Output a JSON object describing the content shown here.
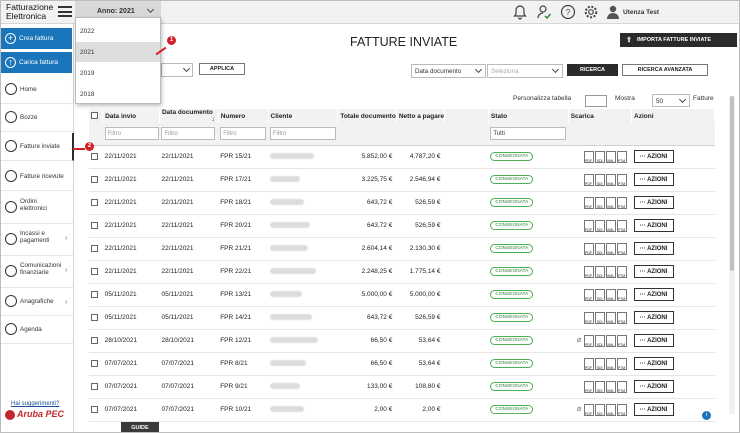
{
  "brand": {
    "line1": "Fatturazione",
    "line2": "Elettronica"
  },
  "year_select": {
    "label": "Anno: 2021"
  },
  "year_dropdown": {
    "options": [
      "2022",
      "2021",
      "2019",
      "2018"
    ],
    "selected": "2021"
  },
  "user": {
    "name": "Utenza Test"
  },
  "sidebar": {
    "buttons": [
      {
        "label": "Crea fattura"
      },
      {
        "label": "Carica fattura"
      }
    ],
    "items": [
      {
        "label": "Home",
        "icon": "home-icon"
      },
      {
        "label": "Bozze",
        "icon": "drafts-icon"
      },
      {
        "label": "Fatture inviate",
        "icon": "sent-icon"
      },
      {
        "label": "Fatture ricevute",
        "icon": "received-icon"
      },
      {
        "label": "Ordini elettronici",
        "icon": "orders-icon"
      },
      {
        "label": "Incassi e pagamenti",
        "icon": "payments-icon"
      },
      {
        "label": "Comunicazioni finanziarie",
        "icon": "communications-icon"
      },
      {
        "label": "Anagrafiche",
        "icon": "registry-icon"
      },
      {
        "label": "Agenda",
        "icon": "agenda-icon"
      }
    ],
    "suggestion": "Hai suggerimenti?",
    "logo": "Aruba PEC"
  },
  "page": {
    "title": "FATTURE INVIATE",
    "import_label": "IMPORTA FATTURE INVIATE"
  },
  "filters": {
    "apply_label": "APPLICA",
    "date_field": "Data documento",
    "select_placeholder": "Seleziona",
    "search_label": "RICERCA",
    "advanced_label": "RICERCA AVANZATA"
  },
  "table_tools": {
    "personalize": "Personalizza tabella",
    "show": "Mostra",
    "per_page": "50",
    "unit": "Fatture"
  },
  "table": {
    "headers": [
      "Data invio",
      "Data documento",
      "Numero",
      "Cliente",
      "Totale documento",
      "Netto a pagare",
      "",
      "Stato",
      "Scarica",
      "Azioni"
    ],
    "filter_placeholder": "Filtro",
    "status_filter": "Tutti",
    "azioni_label": "··· AZIONI",
    "rows": [
      {
        "invio": "22/11/2021",
        "doc": "22/11/2021",
        "num": "FPR 15/21",
        "tot": "5.852,00 €",
        "netto": "4.787,20 €",
        "stato": "CONSEGNATA"
      },
      {
        "invio": "22/11/2021",
        "doc": "22/11/2021",
        "num": "FPR 17/21",
        "tot": "3.225,75 €",
        "netto": "2.546,94 €",
        "stato": "CONSEGNATA"
      },
      {
        "invio": "22/11/2021",
        "doc": "22/11/2021",
        "num": "FPR 18/21",
        "tot": "643,72 €",
        "netto": "526,59 €",
        "stato": "CONSEGNATA"
      },
      {
        "invio": "22/11/2021",
        "doc": "22/11/2021",
        "num": "FPR 20/21",
        "tot": "643,72 €",
        "netto": "526,59 €",
        "stato": "CONSEGNATA"
      },
      {
        "invio": "22/11/2021",
        "doc": "22/11/2021",
        "num": "FPR 21/21",
        "tot": "2.604,14 €",
        "netto": "2.130,30 €",
        "stato": "CONSEGNATA"
      },
      {
        "invio": "22/11/2021",
        "doc": "22/11/2021",
        "num": "FPR 22/21",
        "tot": "2.248,25 €",
        "netto": "1.775,14 €",
        "stato": "CONSEGNATA"
      },
      {
        "invio": "05/11/2021",
        "doc": "05/11/2021",
        "num": "FPR 13/21",
        "tot": "5.000,00 €",
        "netto": "5.000,00 €",
        "stato": "CONSEGNATA"
      },
      {
        "invio": "05/11/2021",
        "doc": "05/11/2021",
        "num": "FPR 14/21",
        "tot": "643,72 €",
        "netto": "526,59 €",
        "stato": "CONSEGNATA"
      },
      {
        "invio": "28/10/2021",
        "doc": "28/10/2021",
        "num": "FPR 12/21",
        "tot": "66,50 €",
        "netto": "53,64 €",
        "stato": "CONSEGNATA"
      },
      {
        "invio": "07/07/2021",
        "doc": "07/07/2021",
        "num": "FPR 8/21",
        "tot": "66,50 €",
        "netto": "53,64 €",
        "stato": "CONSEGNATA"
      },
      {
        "invio": "07/07/2021",
        "doc": "07/07/2021",
        "num": "FPR 9/21",
        "tot": "133,00 €",
        "netto": "108,80 €",
        "stato": "CONSEGNATA"
      },
      {
        "invio": "07/07/2021",
        "doc": "07/07/2021",
        "num": "FPR 10/21",
        "tot": "2,00 €",
        "netto": "2,00 €",
        "stato": "CONSEGNATA"
      }
    ],
    "download_labels": [
      "PDF",
      "SDI",
      "XML",
      "P7M"
    ]
  },
  "markers": [
    "1",
    "2"
  ],
  "guide_label": "GUIDE",
  "colors": {
    "accent": "#1b75bb",
    "dark": "#2b2b2b",
    "marker": "#d32027",
    "status": "#4caf50"
  }
}
